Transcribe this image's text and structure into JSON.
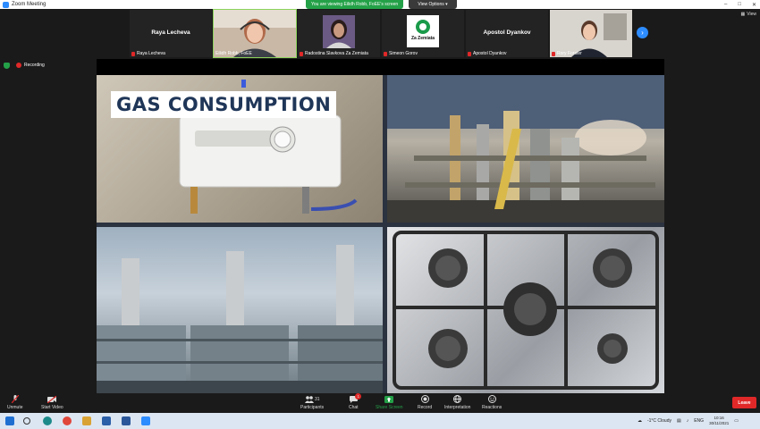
{
  "window": {
    "title": "Zoom Meeting",
    "controls": [
      "–",
      "□",
      "✕"
    ]
  },
  "banner": {
    "viewing": "You are viewing Eilidh Robb, FoEE's screen",
    "view_options": "View Options"
  },
  "participants": [
    {
      "name": "Raya Lecheva",
      "big_name": "Raya Lecheva",
      "muted": true
    },
    {
      "name": "Eilidh Robb, FoEE",
      "big_name": "",
      "muted": false,
      "active": true
    },
    {
      "name": "Radostina Slavkova Za Zemiata",
      "big_name": "",
      "muted": true
    },
    {
      "name": "Simeon Gorov",
      "big_name": "",
      "muted": true,
      "logo_text": "Za Zemiata"
    },
    {
      "name": "Apostol Dyankov",
      "big_name": "Apostol Dyankov",
      "muted": true
    },
    {
      "name": "Rory Forster",
      "big_name": "",
      "muted": true
    }
  ],
  "view_label": "View",
  "recording": "Recording",
  "slide": {
    "title": "GAS CONSUMPTION"
  },
  "toolbar": {
    "unmute": "Unmute",
    "start_video": "Start Video",
    "participants": "Participants",
    "participants_count": "31",
    "chat": "Chat",
    "chat_badge": "1",
    "share_screen": "Share Screen",
    "record": "Record",
    "interpretation": "Interpretation",
    "reactions": "Reactions",
    "leave": "Leave"
  },
  "taskbar": {
    "weather": "-1°C  Cloudy",
    "language": "ENG",
    "time": "10:16",
    "date": "30/11/2021"
  },
  "colors": {
    "zoom_blue": "#2d8cff",
    "leave_red": "#e02828",
    "share_green": "#24a148"
  }
}
